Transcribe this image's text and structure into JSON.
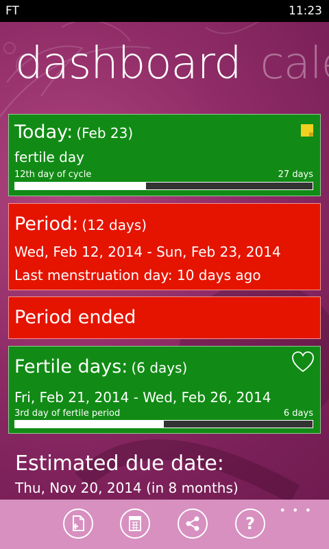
{
  "status": {
    "carrier": "FT",
    "time": "11:23"
  },
  "pivot": {
    "active": "dashboard",
    "next": "cale"
  },
  "today": {
    "label": "Today:",
    "date": "(Feb 23)",
    "status": "fertile day",
    "cycle_label": "12th day of cycle",
    "cycle_total": "27 days",
    "progress_fraction": 0.44
  },
  "period": {
    "label": "Period:",
    "duration": "(12 days)",
    "range": "Wed, Feb 12, 2014 - Sun, Feb 23, 2014",
    "last_day": "Last menstruation day: 10 days ago"
  },
  "period_status": "Period ended",
  "fertile": {
    "label": "Fertile days:",
    "duration": "(6 days)",
    "range": "Fri, Feb 21, 2014 - Wed, Feb 26, 2014",
    "progress_label": "3rd day of fertile period",
    "progress_total": "6 days",
    "progress_fraction": 0.5
  },
  "due": {
    "title": "Estimated due date:",
    "value": "Thu, Nov 20, 2014 (in 8 months)"
  },
  "appbar": {
    "buttons": [
      "add-note-icon",
      "calendar-icon",
      "share-icon",
      "help-icon"
    ],
    "more": "• • •"
  },
  "colors": {
    "green": "#118b15",
    "red": "#e51400",
    "appbar": "#d790c0"
  }
}
